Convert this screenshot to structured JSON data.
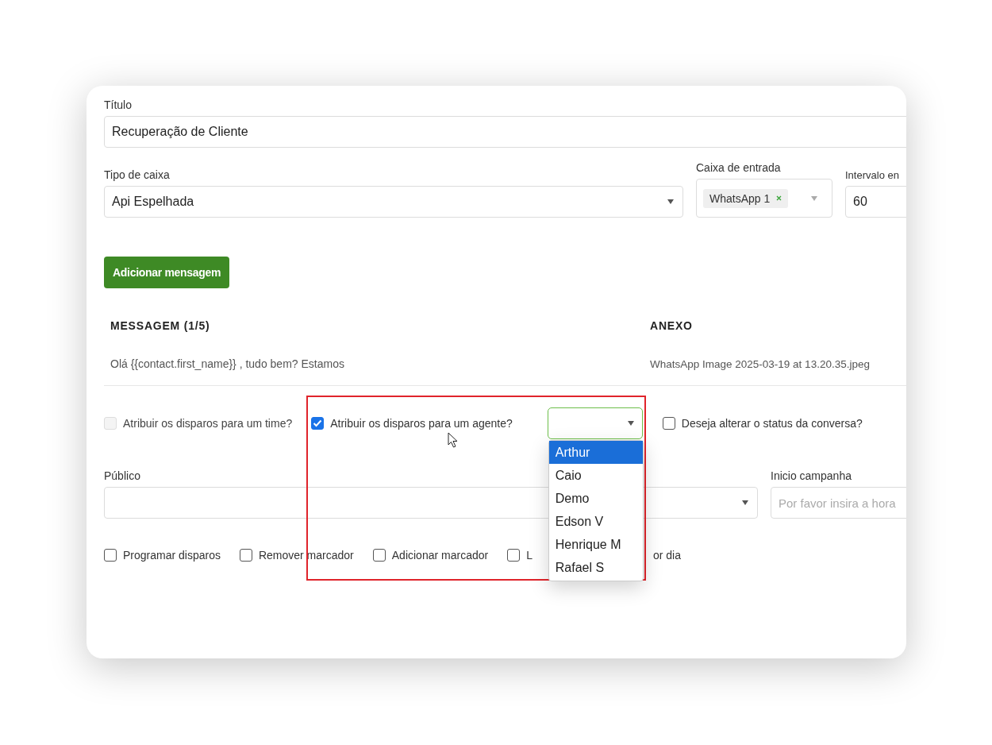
{
  "form": {
    "title_field": {
      "label": "Título",
      "value": "Recuperação de Cliente"
    },
    "box_type": {
      "label": "Tipo de caixa",
      "value": "Api Espelhada"
    },
    "inbox": {
      "label": "Caixa de entrada",
      "tags": [
        {
          "label": "WhatsApp 1"
        }
      ]
    },
    "interval": {
      "label": "Intervalo en",
      "value": "60"
    },
    "add_message_button": "Adicionar mensagem",
    "table": {
      "columns": [
        "MESSAGEM (1/5)",
        "ANEXO"
      ],
      "rows": [
        [
          "Olá {{contact.first_name}} , tudo bem? Estamos",
          "WhatsApp Image 2025-03-19 at 13.20.35.jpeg"
        ]
      ]
    },
    "assign_options": [
      {
        "kind": "checkbox",
        "label": "Atribuir os disparos para um time?",
        "checked": false,
        "disabled": true
      },
      {
        "kind": "checkbox",
        "label": "Atribuir os disparos para um agente?",
        "checked": true,
        "disabled": false
      },
      {
        "kind": "select",
        "expanded": true,
        "options": [
          {
            "label": "Arthur",
            "selected": true
          },
          {
            "label": "Caio",
            "selected": false
          },
          {
            "label": "Demo",
            "selected": false
          },
          {
            "label": "Edson V",
            "selected": false
          },
          {
            "label": "Henrique M",
            "selected": false
          },
          {
            "label": "Rafael S",
            "selected": false
          }
        ]
      },
      {
        "kind": "checkbox",
        "label": "Deseja alterar o status da conversa?",
        "checked": false,
        "disabled": false
      }
    ],
    "audience": {
      "label": "Público"
    },
    "campaign_start": {
      "label": "Inicio campanha",
      "placeholder": "Por favor insira a hora"
    },
    "options": [
      {
        "label": "Programar disparos",
        "checked": false
      },
      {
        "label": "Remover marcador",
        "checked": false
      },
      {
        "label": "Adicionar marcador",
        "checked": false
      },
      {
        "label_start": "L",
        "label_end": "or dia",
        "checked": false
      }
    ]
  }
}
